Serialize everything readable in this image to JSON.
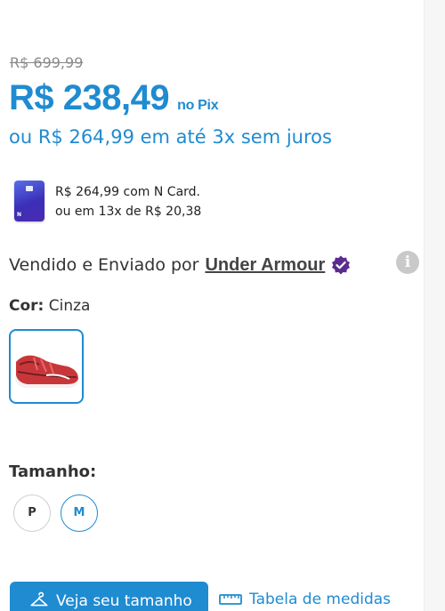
{
  "price": {
    "old": "R$ 699,99",
    "pix_amount": "R$ 238,49",
    "pix_suffix": "no Pix",
    "installments": "ou R$ 264,99 em até 3x sem juros"
  },
  "ncard": {
    "line1": "R$ 264,99 com N Card.",
    "line2": "ou em 13x de R$ 20,38"
  },
  "seller": {
    "prefix": "Vendido e Enviado por",
    "name": "Under Armour"
  },
  "color": {
    "label": "Cor:",
    "value": "Cinza"
  },
  "size": {
    "title": "Tamanho:",
    "options": [
      "P",
      "M"
    ],
    "selected": "M"
  },
  "actions": {
    "find_size": "Veja seu tamanho",
    "size_chart": "Tabela de medidas"
  },
  "colors": {
    "accent": "#1f8bd1",
    "verified": "#5b2c8f"
  },
  "icons": {
    "card": "credit-card-icon",
    "verified": "verified-badge-icon",
    "info": "info-icon",
    "hanger": "hanger-icon",
    "ruler": "ruler-icon"
  }
}
